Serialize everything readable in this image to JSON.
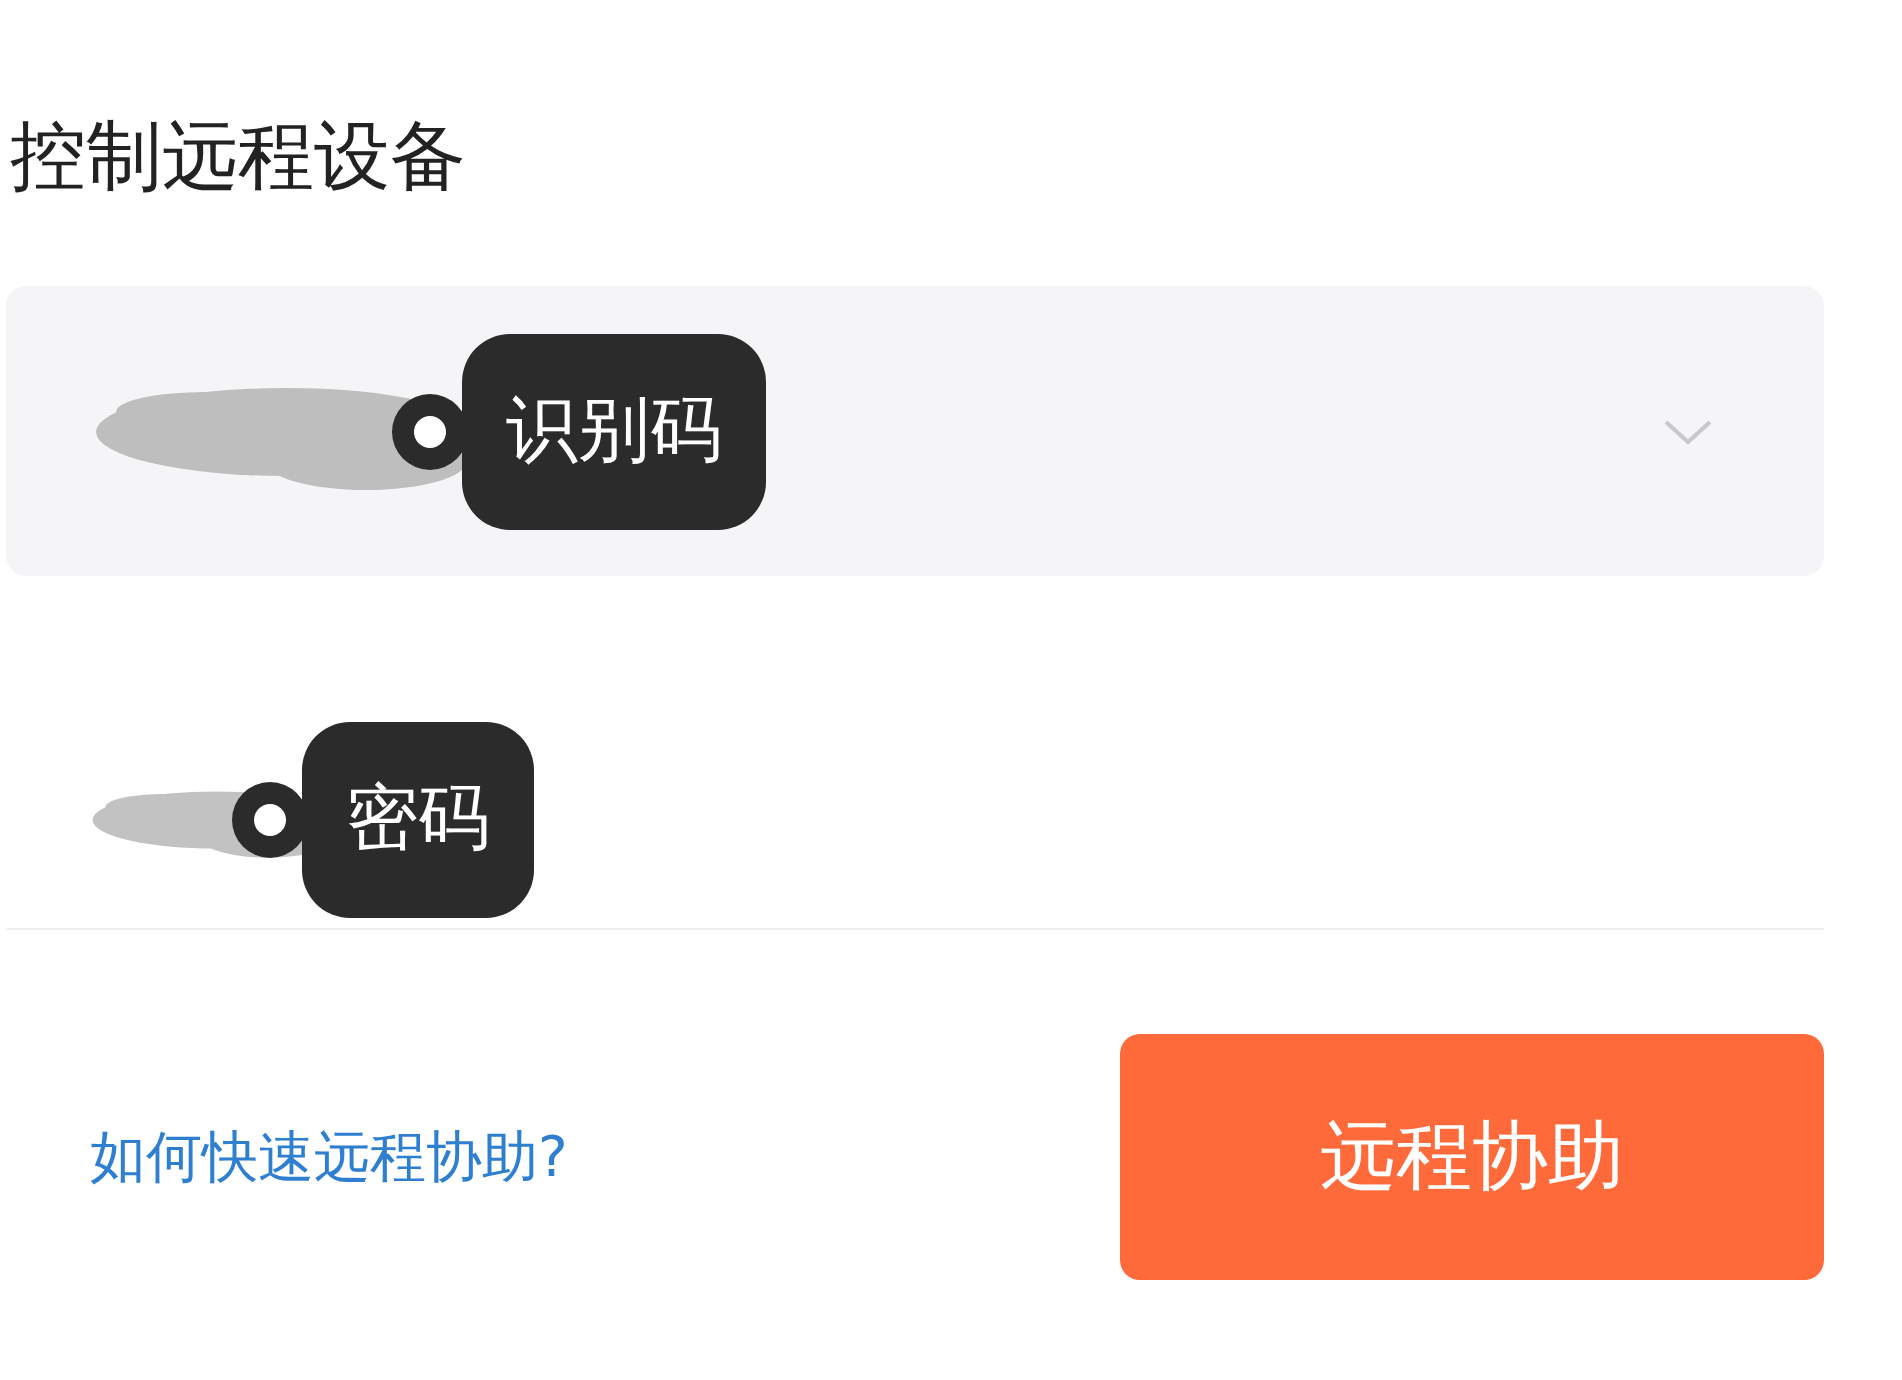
{
  "title": "控制远程设备",
  "fields": [
    {
      "kind": "dropdown",
      "callout": "识别码"
    },
    {
      "kind": "text",
      "callout": "密码"
    }
  ],
  "help_link": "如何快速远程协助?",
  "submit_button": "远程协助"
}
